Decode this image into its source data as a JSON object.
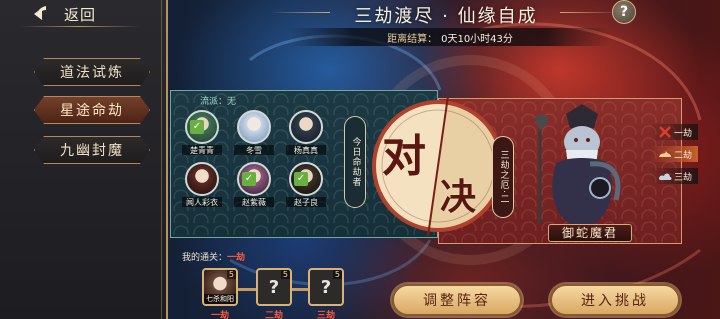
{
  "header": {
    "back_label": "返回",
    "title": "三劫渡尽 · 仙缘自成",
    "countdown_label": "距离结算：",
    "countdown_value": "0天10小时43分",
    "help_label": "?"
  },
  "sidebar": {
    "items": [
      {
        "label": "道法试炼",
        "active": false
      },
      {
        "label": "星途命劫",
        "active": true
      },
      {
        "label": "九幽封魔",
        "active": false
      }
    ]
  },
  "today": {
    "faction_label": "流派：",
    "faction_value": "无",
    "tag_label": "今日命劫者",
    "heroes": [
      {
        "name": "楚青青",
        "checked": true
      },
      {
        "name": "冬雪",
        "checked": false
      },
      {
        "name": "杨真真",
        "checked": false
      },
      {
        "name": "闻人彩衣",
        "checked": false
      },
      {
        "name": "赵紫薇",
        "checked": true
      },
      {
        "name": "赵子良",
        "checked": true
      }
    ]
  },
  "duel": {
    "char1": "对",
    "char2": "决",
    "calamity_tag": "三劫之厄·二"
  },
  "boss": {
    "name": "御蛇魔君"
  },
  "stage_tabs": [
    {
      "label": "一劫",
      "active": false,
      "icon": "defeated-x-icon"
    },
    {
      "label": "二劫",
      "active": true,
      "icon": "flame-cloud-icon"
    },
    {
      "label": "三劫",
      "active": false,
      "icon": "cloud-icon"
    }
  ],
  "progress": {
    "clear_label": "我的通关：",
    "clear_value": "一劫",
    "cards": [
      {
        "label": "一劫",
        "corner": "5",
        "caption": "七杀和阳",
        "locked": false
      },
      {
        "label": "二劫",
        "corner": "5",
        "caption": "",
        "locked": true
      },
      {
        "label": "三劫",
        "corner": "5",
        "caption": "",
        "locked": true
      }
    ]
  },
  "actions": {
    "adjust_label": "调整阵容",
    "enter_label": "进入挑战"
  },
  "colors": {
    "accent_gold": "#b8925a",
    "highlight_red": "#ff5a3c",
    "active_tab": "#c6612b"
  }
}
